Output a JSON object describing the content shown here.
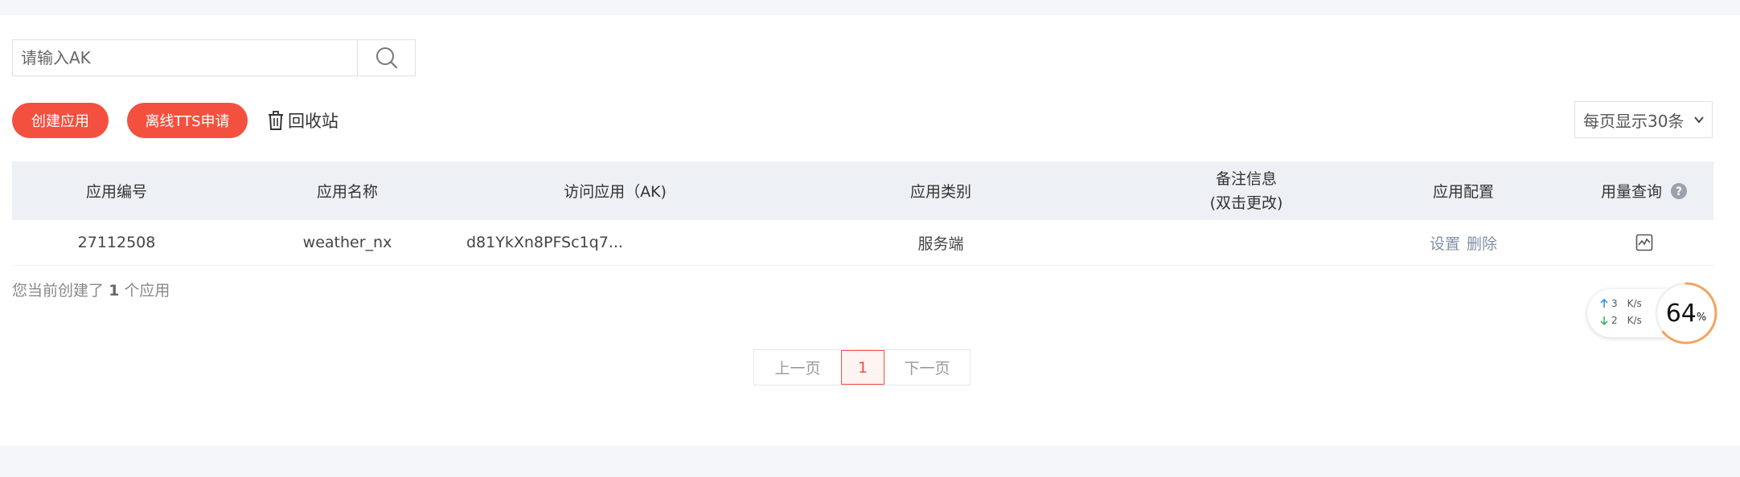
{
  "search": {
    "placeholder": "请输入AK"
  },
  "toolbar": {
    "create_label": "创建应用",
    "tts_label": "离线TTS申请",
    "recycle_label": "回收站",
    "page_size_label": "每页显示30条"
  },
  "table": {
    "headers": {
      "id": "应用编号",
      "name": "应用名称",
      "ak": "访问应用（AK)",
      "type": "应用类别",
      "remark_line1": "备注信息",
      "remark_line2": "(双击更改)",
      "config": "应用配置",
      "usage": "用量查询"
    },
    "rows": [
      {
        "id": "27112508",
        "name": "weather_nx",
        "ak": "d81YkXn8PFSc1q7...",
        "type": "服务端",
        "remark": "",
        "config_set": "设置",
        "config_delete": "删除"
      }
    ]
  },
  "summary": {
    "prefix": "您当前创建了",
    "count": "1",
    "suffix": "个应用"
  },
  "pagination": {
    "prev": "上一页",
    "current": "1",
    "next": "下一页"
  },
  "net_widget": {
    "upload": "3",
    "download": "2",
    "unit": "K/s",
    "percent": "64",
    "percent_unit": "%"
  },
  "colors": {
    "accent": "#f4503f",
    "header_bg": "#edf0f4",
    "link": "#8091a5"
  }
}
